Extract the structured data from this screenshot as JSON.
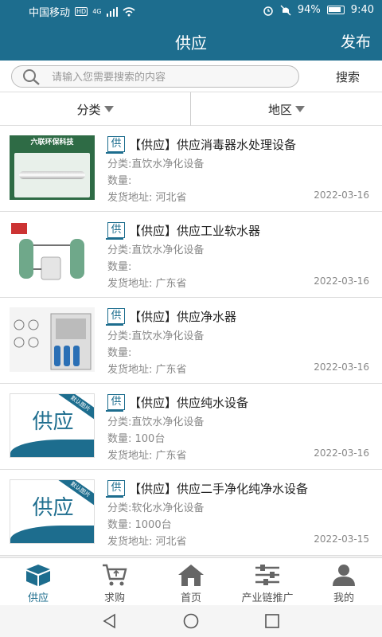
{
  "status": {
    "carrier": "中国移动",
    "hd": "HD",
    "net": "4G",
    "battery": "94%",
    "time": "9:40"
  },
  "header": {
    "title": "供应",
    "publish_label": "发布"
  },
  "search": {
    "placeholder": "请输入您需要搜索的内容",
    "button_label": "搜索"
  },
  "filters": {
    "category_label": "分类",
    "region_label": "地区"
  },
  "items": [
    {
      "tag": "供",
      "title": "【供应】供应消毒器水处理设备",
      "category": "分类:直饮水净化设备",
      "quantity": "数量:",
      "address": "发货地址:  河北省",
      "date": "2022-03-16",
      "thumb_header": "六联环保科技"
    },
    {
      "tag": "供",
      "title": "【供应】供应工业软水器",
      "category": "分类:直饮水净化设备",
      "quantity": "数量:",
      "address": "发货地址:  广东省",
      "date": "2022-03-16"
    },
    {
      "tag": "供",
      "title": "【供应】供应净水器",
      "category": "分类:直饮水净化设备",
      "quantity": "数量:",
      "address": "发货地址:  广东省",
      "date": "2022-03-16"
    },
    {
      "tag": "供",
      "title": "【供应】供应纯水设备",
      "category": "分类:直饮水净化设备",
      "quantity": "数量:  100台",
      "address": "发货地址:  广东省",
      "date": "2022-03-16",
      "thumb_text": "供应",
      "thumb_ribbon": "默认图片"
    },
    {
      "tag": "供",
      "title": "【供应】供应二手净化纯净水设备",
      "category": "分类:软化水净化设备",
      "quantity": "数量:  1000台",
      "address": "发货地址:  河北省",
      "date": "2022-03-15",
      "thumb_text": "供应",
      "thumb_ribbon": "默认图片"
    }
  ],
  "tabs": [
    {
      "label": "供应",
      "icon": "box-icon"
    },
    {
      "label": "求购",
      "icon": "cart-icon"
    },
    {
      "label": "首页",
      "icon": "home-icon"
    },
    {
      "label": "产业链推广",
      "icon": "sliders-icon"
    },
    {
      "label": "我的",
      "icon": "user-icon"
    }
  ],
  "colors": {
    "primary": "#1d6d8e",
    "background": "#f2f2f2"
  }
}
